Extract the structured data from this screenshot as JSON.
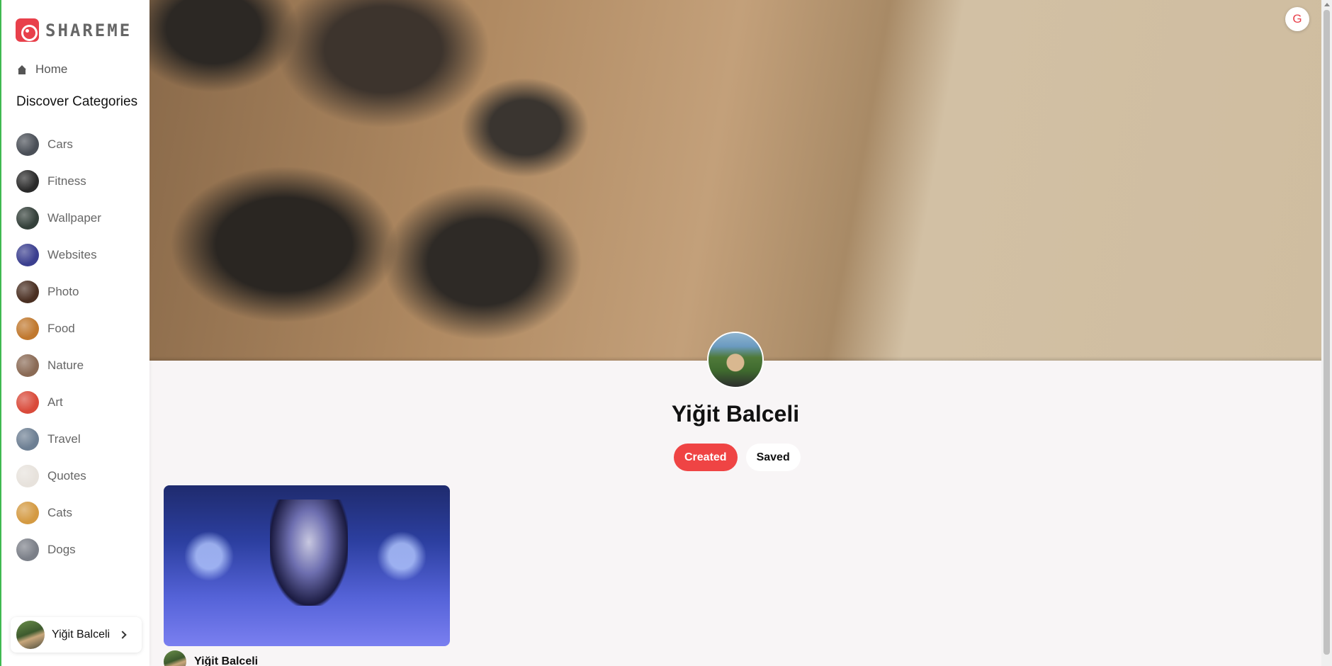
{
  "brand": {
    "name": "SHAREME",
    "accent": "#e8404b"
  },
  "sidebar": {
    "home_label": "Home",
    "discover_heading": "Discover Categories",
    "categories": [
      {
        "label": "Cars",
        "thumb": "#4a4f57"
      },
      {
        "label": "Fitness",
        "thumb": "#2a2a2a"
      },
      {
        "label": "Wallpaper",
        "thumb": "#34403a"
      },
      {
        "label": "Websites",
        "thumb": "#3b3f8f"
      },
      {
        "label": "Photo",
        "thumb": "#4a2f22"
      },
      {
        "label": "Food",
        "thumb": "#c0782e"
      },
      {
        "label": "Nature",
        "thumb": "#8a6a55"
      },
      {
        "label": "Art",
        "thumb": "#d94a3a"
      },
      {
        "label": "Travel",
        "thumb": "#6d7f93"
      },
      {
        "label": "Quotes",
        "thumb": "#e7e2dc"
      },
      {
        "label": "Cats",
        "thumb": "#d49a42"
      },
      {
        "label": "Dogs",
        "thumb": "#7b7f88"
      }
    ],
    "user": {
      "name": "Yiğit Balceli"
    }
  },
  "header": {
    "login_icon": "G"
  },
  "profile": {
    "name": "Yiğit Balceli",
    "tabs": [
      {
        "label": "Created",
        "active": true
      },
      {
        "label": "Saved",
        "active": false
      }
    ]
  },
  "pins": [
    {
      "author": "Yiğit Balceli"
    }
  ]
}
